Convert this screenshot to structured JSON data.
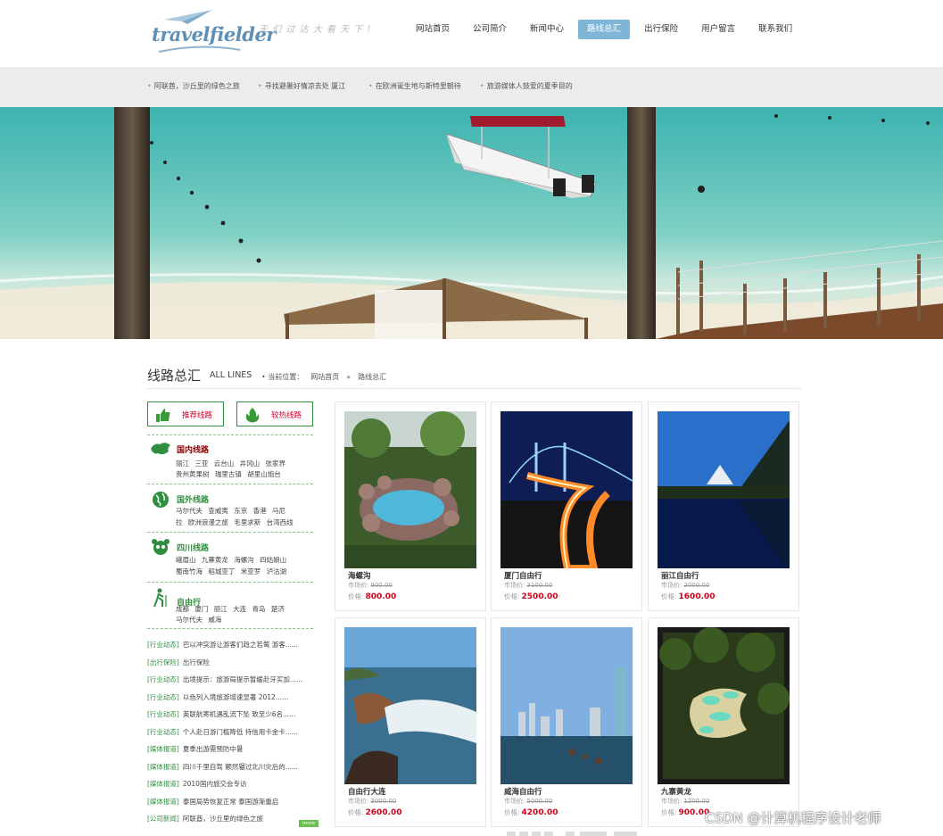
{
  "header": {
    "logo_text": "travelfielder",
    "slogan": "天 们 过 达 大 看 天 下 !",
    "nav": [
      {
        "label": "网站首页",
        "active": false
      },
      {
        "label": "公司简介",
        "active": false
      },
      {
        "label": "新闻中心",
        "active": false
      },
      {
        "label": "路线总汇",
        "active": true
      },
      {
        "label": "出行保险",
        "active": false
      },
      {
        "label": "用户留言",
        "active": false
      },
      {
        "label": "联系我们",
        "active": false
      }
    ]
  },
  "newsbar": [
    "阿联酋，沙丘里的绿色之旅",
    "寻找避暑好情凉去处 厦江",
    "在欧洲诞生地与斯特里朝待",
    "旅游媒体人鼓爱的夏季目的"
  ],
  "section": {
    "title_cn": "线路总汇",
    "title_en": "ALL LINES",
    "crumb_prefix": "• 当前位置：",
    "crumb_home": "网站首页",
    "crumb_sep": "»",
    "crumb_current": "路线总汇"
  },
  "sidebar": {
    "buttons": [
      "推荐线路",
      "较热线路"
    ],
    "categories": [
      {
        "title": "国内线路",
        "color": "#8b0000",
        "lines": [
          "丽江 三亚 云台山 井冈山 张家界",
          "贵州黄果树 瑞里古镇 胡里山炮台"
        ]
      },
      {
        "title": "国外线路",
        "color": "#2f8f3f",
        "lines": [
          "马尔代夫 查威夷 东京 香港 马尼",
          "拉 欧洲浪漫之旅 毛里求斯 台湾西线"
        ]
      },
      {
        "title": "四川线路",
        "color": "#2f8f3f",
        "lines": [
          "峨眉山 九寨黄龙 海螺沟 四姑娘山",
          "蜀南竹海 稻城亚丁 米亚罗 泸沽湖"
        ]
      },
      {
        "title": "自由行",
        "color": "#2f8f3f",
        "lines": [
          "成都 厦门 丽江 大连 青岛 楚济",
          "马尔代夫 威海"
        ]
      }
    ],
    "news": [
      {
        "tag": "[行业动态]",
        "text": "巴以冲突游让游客们趋之若鹜 游客......"
      },
      {
        "tag": "[出行保险]",
        "text": "出行保险"
      },
      {
        "tag": "[行业动态]",
        "text": "出境提示：旅游局提示暂缓赴牙买加......"
      },
      {
        "tag": "[行业动态]",
        "text": "以色列入境旅游增速显著 2012......"
      },
      {
        "tag": "[行业动态]",
        "text": "英联航寄机遇乱流下坠 致至少6名......"
      },
      {
        "tag": "[行业动态]",
        "text": "个人赴日游门槛降低 持信用卡金卡......"
      },
      {
        "tag": "[媒体报道]",
        "text": "夏季出游需预防中暑"
      },
      {
        "tag": "[媒体报道]",
        "text": "四川千里自驾 颤然辗过北川灾后的......"
      },
      {
        "tag": "[媒体报道]",
        "text": "2010国内旅交会专访"
      },
      {
        "tag": "[媒体报道]",
        "text": "泰国局势恢复正常 泰国游渐重启"
      },
      {
        "tag": "[公司新闻]",
        "text": "阿联酋，沙丘里的绿色之旅"
      }
    ],
    "more": "more"
  },
  "products": [
    {
      "name": "海螺沟",
      "market_label": "市场价:",
      "market": "900.00",
      "price_label": "价格:",
      "price": "800.00",
      "scene": "pool"
    },
    {
      "name": "厦门自由行",
      "market_label": "市场价:",
      "market": "3100.00",
      "price_label": "价格:",
      "price": "2500.00",
      "scene": "bridge"
    },
    {
      "name": "丽江自由行",
      "market_label": "市场价:",
      "market": "2000.00",
      "price_label": "价格:",
      "price": "1600.00",
      "scene": "lake"
    },
    {
      "name": "自由行大连",
      "market_label": "市场价:",
      "market": "3000.00",
      "price_label": "价格:",
      "price": "2600.00",
      "scene": "coast"
    },
    {
      "name": "威海自由行",
      "market_label": "市场价:",
      "market": "5000.00",
      "price_label": "价格:",
      "price": "4200.00",
      "scene": "city"
    },
    {
      "name": "九寨黄龙",
      "market_label": "市场价:",
      "market": "1200.00",
      "price_label": "价格:",
      "price": "900.00",
      "scene": "terrace"
    }
  ],
  "watermark": "CSDN @计算机程序设计老师",
  "colors": {
    "accent": "#7fb6d8",
    "price": "#d0021b",
    "green": "#2f8f3f"
  }
}
